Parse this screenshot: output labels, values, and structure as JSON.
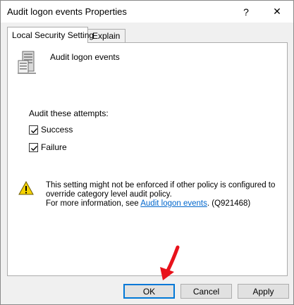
{
  "window": {
    "title": "Audit logon events Properties",
    "help_glyph": "?",
    "close_glyph": "✕"
  },
  "tabs": [
    {
      "label": "Local Security Setting"
    },
    {
      "label": "Explain"
    }
  ],
  "policy": {
    "name": "Audit logon events",
    "icon": "server-policy-icon"
  },
  "audit": {
    "label": "Audit these attempts:",
    "options": [
      {
        "label": "Success",
        "checked": true
      },
      {
        "label": "Failure",
        "checked": true
      }
    ]
  },
  "warning": {
    "icon": "warning-icon",
    "line1": "This setting might not be enforced if other policy is configured to",
    "line2": "override category level audit policy.",
    "line3_prefix": "For more information, see ",
    "link": "Audit logon events",
    "line3_suffix": ". (Q921468)"
  },
  "buttons": {
    "ok": "OK",
    "cancel": "Cancel",
    "apply": "Apply"
  },
  "colors": {
    "link": "#0066cc",
    "focus_border": "#0078d7",
    "annotation_arrow": "#e8121b"
  }
}
